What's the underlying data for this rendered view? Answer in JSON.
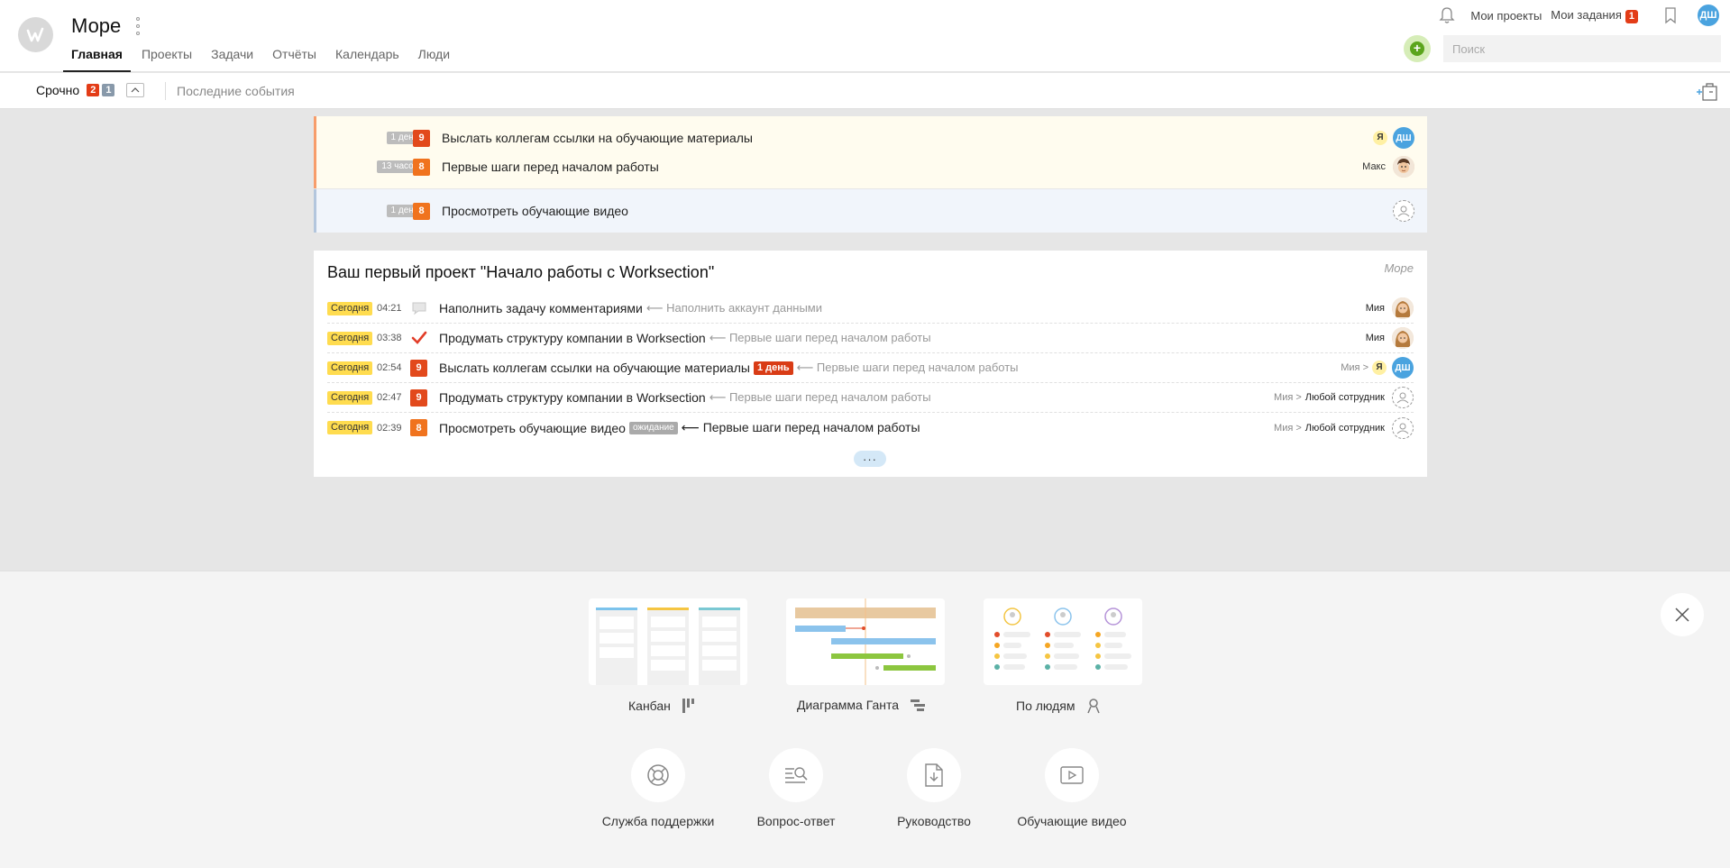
{
  "header": {
    "title": "Море",
    "nav": [
      "Главная",
      "Проекты",
      "Задачи",
      "Отчёты",
      "Календарь",
      "Люди"
    ],
    "my_projects": "Мои проекты",
    "my_tasks": "Мои задания",
    "my_tasks_count": "1",
    "user_initials": "ДШ",
    "search_placeholder": "Поиск"
  },
  "subbar": {
    "urgent_label": "Срочно",
    "urgent_count": "2",
    "other_count": "1",
    "recent_events": "Последние события"
  },
  "urgent_tasks": [
    {
      "age": "1 день",
      "priority": "9",
      "name": "Выслать коллегам ссылки на обучающие материалы",
      "assignee_badge": "Я",
      "avatar": "ДШ"
    },
    {
      "age": "13 часов",
      "priority": "8",
      "name": "Первые шаги перед началом работы",
      "assignee": "Макс"
    }
  ],
  "normal_tasks": [
    {
      "age": "1 день",
      "priority": "8",
      "name": "Просмотреть обучающие видео"
    }
  ],
  "project": {
    "title": "Ваш первый проект \"Начало работы с Worksection\"",
    "tag": "Море",
    "events": [
      {
        "day": "Сегодня",
        "time": "04:21",
        "name": "Наполнить задачу комментариями",
        "parent": "⟵ Наполнить аккаунт данными",
        "assignee": "Мия"
      },
      {
        "day": "Сегодня",
        "time": "03:38",
        "name": "Продумать структуру компании в Worksection",
        "parent": "⟵ Первые шаги перед началом работы",
        "assignee": "Мия"
      },
      {
        "day": "Сегодня",
        "time": "02:54",
        "priority": "9",
        "name": "Выслать коллегам ссылки на обучающие материалы",
        "late": "1 день",
        "parent": "⟵ Первые шаги перед началом работы",
        "from": "Мия >",
        "to_badge": "Я",
        "avatar": "ДШ"
      },
      {
        "day": "Сегодня",
        "time": "02:47",
        "priority": "9",
        "name": "Продумать структуру компании в Worksection",
        "parent": "⟵ Первые шаги перед началом работы",
        "from": "Мия >",
        "to": "Любой сотрудник"
      },
      {
        "day": "Сегодня",
        "time": "02:39",
        "priority": "8",
        "name": "Просмотреть обучающие видео",
        "status": "ожидание",
        "parent": "⟵ Первые шаги перед началом работы",
        "from": "Мия >",
        "to": "Любой сотрудник"
      }
    ],
    "more": "···"
  },
  "views": [
    {
      "label": "Канбан",
      "icon": "kanban-icon"
    },
    {
      "label": "Диаграмма Ганта",
      "icon": "gantt-icon"
    },
    {
      "label": "По людям",
      "icon": "people-icon"
    }
  ],
  "help": [
    {
      "label": "Служба поддержки",
      "icon": "lifebuoy-icon"
    },
    {
      "label": "Вопрос-ответ",
      "icon": "faq-search-icon"
    },
    {
      "label": "Руководство",
      "icon": "download-doc-icon"
    },
    {
      "label": "Обучающие видео",
      "icon": "video-play-icon"
    }
  ],
  "colors": {
    "accent_red": "#e33c17",
    "priority_9": "#e2491c",
    "priority_8": "#f0731e",
    "today_badge": "#ffdc4f",
    "avatar_blue": "#4aa3df",
    "add_green": "#5ba51c"
  }
}
